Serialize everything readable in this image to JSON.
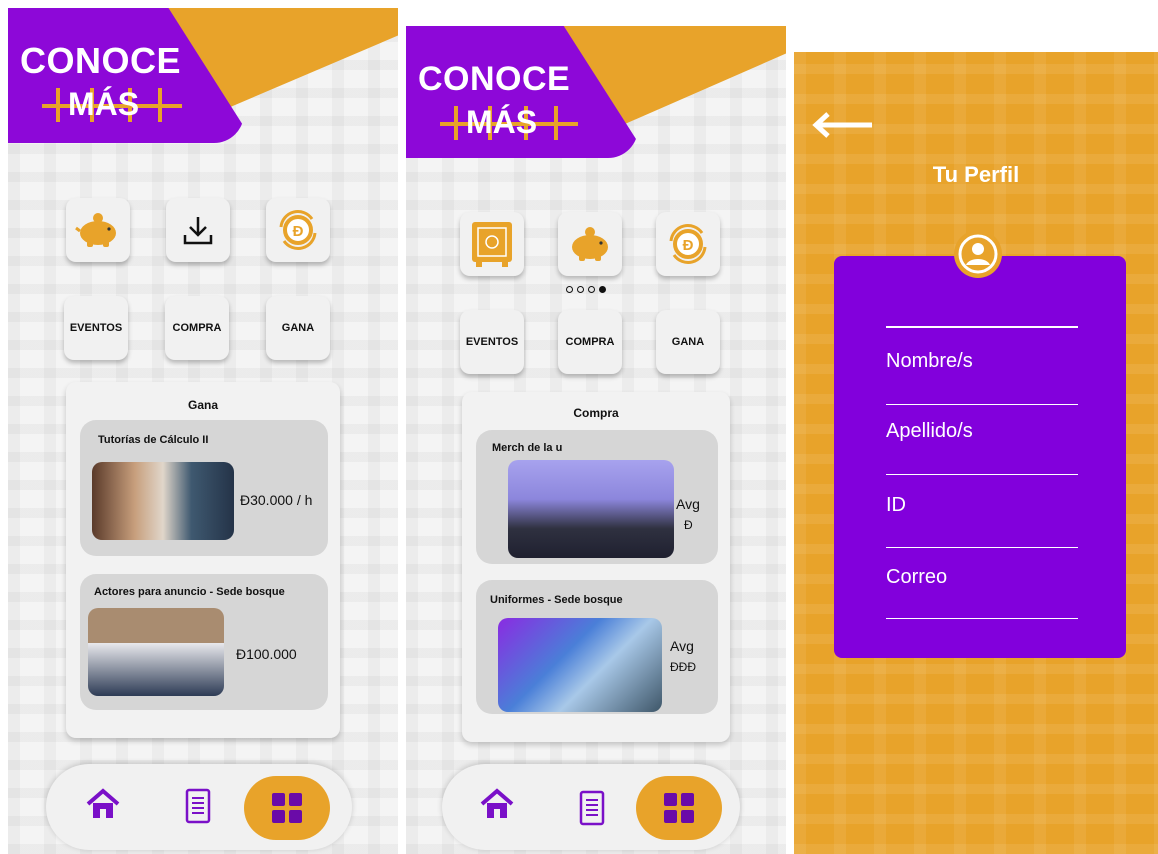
{
  "colors": {
    "purple": "#8d08d8",
    "orange": "#e8a32a",
    "card": "#f2f2f2",
    "item": "#d6d6d6",
    "profile_card": "#8200dc"
  },
  "brand": {
    "line1": "CONOCE",
    "line2": "MÁS"
  },
  "screen1": {
    "icons": [
      "piggy-bank-icon",
      "download-icon",
      "currency-refresh-icon"
    ],
    "categories": [
      "EVENTOS",
      "COMPRA",
      "GANA"
    ],
    "section_title": "Gana",
    "items": [
      {
        "title": "Tutorías de Cálculo II",
        "price": "Đ30.000 / h"
      },
      {
        "title": "Actores para anuncio - Sede bosque",
        "price": "Đ100.000"
      }
    ]
  },
  "screen2": {
    "icons": [
      "safe-icon",
      "piggy-bank-icon",
      "currency-refresh-icon"
    ],
    "carousel": {
      "count": 4,
      "active_index": 3
    },
    "categories": [
      "EVENTOS",
      "COMPRA",
      "GANA"
    ],
    "section_title": "Compra",
    "items": [
      {
        "title": "Merch de la u",
        "price_line1": "Avg",
        "price_line2": "Đ"
      },
      {
        "title": "Uniformes - Sede bosque",
        "price_line1": "Avg",
        "price_line2": "ĐĐĐ"
      }
    ]
  },
  "nav": {
    "items": [
      "home-icon",
      "document-icon",
      "grid-icon"
    ],
    "active": "grid-icon"
  },
  "profile": {
    "title": "Tu Perfil",
    "fields": [
      "Nombre/s",
      "Apellido/s",
      "ID",
      "Correo"
    ]
  }
}
